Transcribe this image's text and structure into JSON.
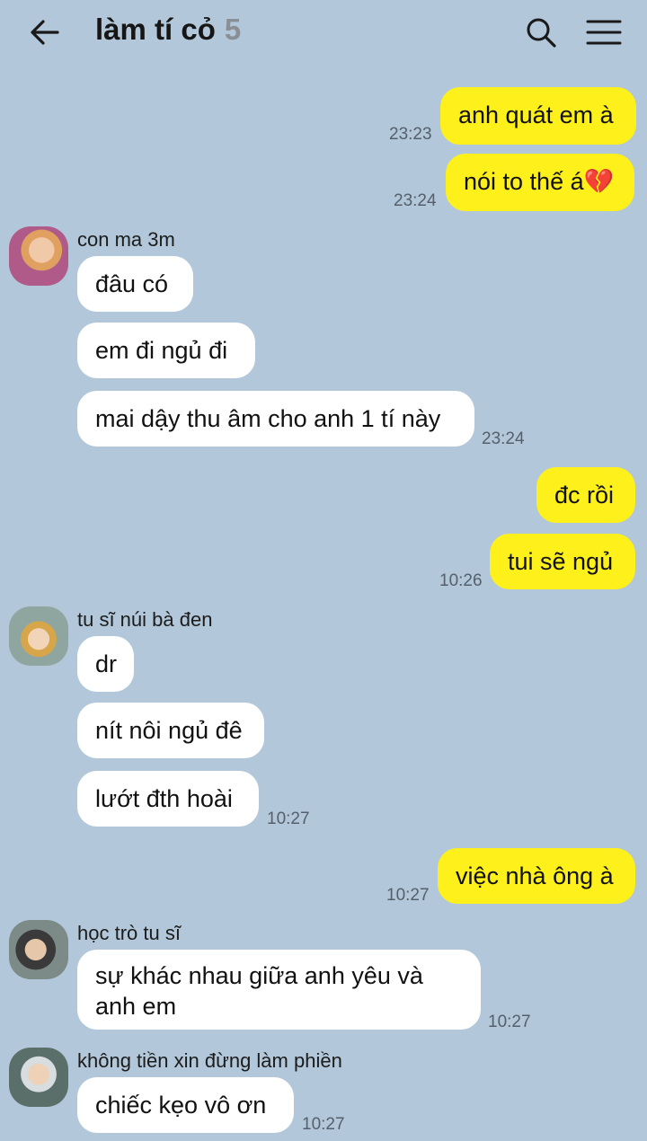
{
  "header": {
    "title": "làm tí cỏ",
    "member_count": "5"
  },
  "colors": {
    "background": "#b2c7d9",
    "my_bubble": "#fef01b",
    "their_bubble": "#ffffff"
  },
  "icons": {
    "back": "arrow-left-icon",
    "search": "search-icon",
    "menu": "hamburger-menu-icon",
    "emoji": "broken-heart-emoji"
  },
  "messages": [
    {
      "text": "anh quát em à",
      "time": "23:23"
    },
    {
      "text": "nói to thế á",
      "time": "23:24",
      "emoji": "💔"
    },
    {
      "sender": "con ma 3m",
      "texts": [
        "đâu có",
        "em đi ngủ đi",
        "mai dậy thu âm cho anh 1 tí này"
      ],
      "time": "23:24"
    },
    {
      "text": "đc rồi"
    },
    {
      "text": "tui sẽ ngủ",
      "time": "10:26"
    },
    {
      "sender": "tu sĩ núi bà đen",
      "texts": [
        "dr",
        "nít nôi ngủ đê",
        "lướt đth hoài"
      ],
      "time": "10:27"
    },
    {
      "text": "việc nhà ông à",
      "time": "10:27"
    },
    {
      "sender": "học trò tu sĩ",
      "texts": [
        "sự khác nhau giữa anh yêu và anh em"
      ],
      "time": "10:27"
    },
    {
      "sender": "không tiền xin đừng làm phiền",
      "texts": [
        "chiếc kẹo vô ơn"
      ],
      "time": "10:27"
    }
  ]
}
